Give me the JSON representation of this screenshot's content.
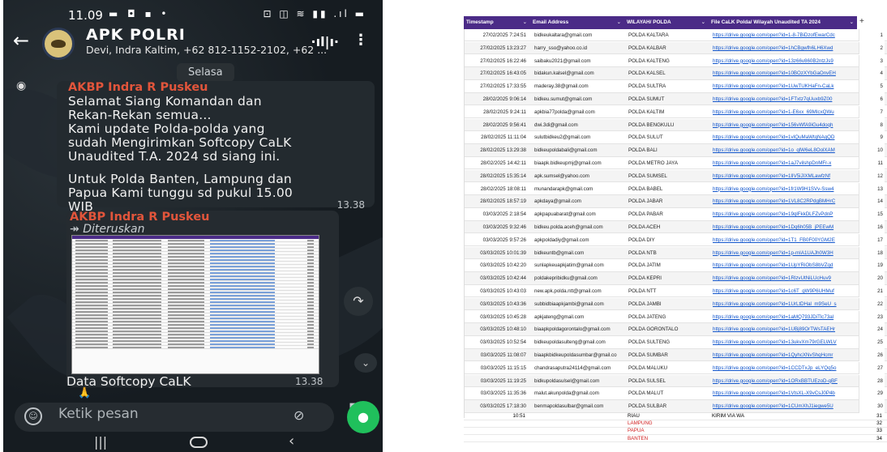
{
  "phone": {
    "status": {
      "time": "11.09"
    },
    "header": {
      "title": "APK POLRI",
      "subtitle": "Devi, Indra Kaltim, +62 812-1152-2102, +62 ..."
    },
    "day_chip": "Selasa",
    "message1": {
      "sender": "AKBP Indra R Puskeu",
      "text1": "Selamat Siang Komandan dan\nRekan-Rekan semua...\nKami update Polda-polda yang\nsudah Mengirimkan Softcopy CaLK\nUnaudited T.A. 2024 sd siang ini.",
      "text2": "Untuk Polda Banten, Lampung dan\nPapua Kami tunggu sd pukul 15.00\nWIB\nDUM, Trims 🙏",
      "time": "13.38"
    },
    "message2": {
      "sender": "AKBP Indra R Puskeu",
      "forwarded": "Diteruskan",
      "caption": "Data Softcopy CaLK",
      "time": "13.38"
    },
    "input_placeholder": "Ketik pesan",
    "accent_green": "#20c05c",
    "sender_color": "#e2553b"
  },
  "sheet": {
    "header_color": "#4b2b87",
    "columns": [
      "Timestamp",
      "Email Address",
      "WILAYAH/ POLDA",
      "File CaLK Polda/ Wilayah Unaudited TA 2024"
    ],
    "rows": [
      {
        "ts": "27/02/2025 7:24:51",
        "email": "bidkeukaltara@gmail.com",
        "polda": "POLDA KALTARA",
        "link": "https://drive.google.com/open?id=1-8-7BiDzofEwarCdc",
        "n": "1"
      },
      {
        "ts": "27/02/2025 13:23:27",
        "email": "harry_sso@yahoo.co.id",
        "polda": "POLDA KALBAR",
        "link": "https://drive.google.com/open?id=1hCBgwfh6LH6Xwd",
        "n": "2"
      },
      {
        "ts": "27/02/2025 16:22:46",
        "email": "saibaku2021@gmail.com",
        "polda": "POLDA KALTENG",
        "link": "https://drive.google.com/open?id=13z66v860B2ntzJs9",
        "n": "3"
      },
      {
        "ts": "27/02/2025 16:43:05",
        "email": "bidakun.kalsel@gmail.com",
        "polda": "POLDA KALSEL",
        "link": "https://drive.google.com/open?id=10BOzXYbGaOnvEH",
        "n": "4"
      },
      {
        "ts": "27/02/2025 17:33:55",
        "email": "maderay.38@gmail.com",
        "polda": "POLDA SULTRA",
        "link": "https://drive.google.com/open?id=1UwTUKHaFn-CaLk",
        "n": "5"
      },
      {
        "ts": "28/02/2025 9:06:14",
        "email": "bidkeu.sumut@gmail.com",
        "polda": "POLDA SUMUT",
        "link": "https://drive.google.com/open?id=1FTxtz7qUuxb9Z00",
        "n": "6"
      },
      {
        "ts": "28/02/2025 9:24:11",
        "email": "apkbia77polda@gmail.com",
        "polda": "POLDA KALTIM",
        "link": "https://drive.google.com/open?id=1-E6xx_69MIcxQWu",
        "n": "7"
      },
      {
        "ts": "28/02/2025 9:56:41",
        "email": "dwi.3di@gmail.com",
        "polda": "POLDA BENGKULU",
        "link": "https://drive.google.com/open?id=156vWfA9iGu4doqh",
        "n": "8"
      },
      {
        "ts": "28/02/2025 11:11:04",
        "email": "sulutbidkeu2@gmail.com",
        "polda": "POLDA SULUT",
        "link": "https://drive.google.com/open?id=1vIQuMaWtqNAqQD",
        "n": "9"
      },
      {
        "ts": "28/02/2025 13:29:38",
        "email": "bidkeupoldabali@gmail.com",
        "polda": "POLDA BALI",
        "link": "https://drive.google.com/open?id=1o_qlW6eL8OolXAM",
        "n": "10"
      },
      {
        "ts": "28/02/2025 14:42:11",
        "email": "biaapk.bidkeupmj@gmail.com",
        "polda": "POLDA METRO JAYA",
        "link": "https://drive.google.com/open?id=1aJ7vilshpDnMFr-x",
        "n": "11"
      },
      {
        "ts": "28/02/2025 15:35:14",
        "email": "apk.sumsel@yahoo.com",
        "polda": "POLDA SUMSEL",
        "link": "https://drive.google.com/open?id=1lIV5iJIXMLawfzNf",
        "n": "12"
      },
      {
        "ts": "28/02/2025 18:08:11",
        "email": "munandarapk@gmail.com",
        "polda": "POLDA BABEL",
        "link": "https://drive.google.com/open?id=1fr1W9H1SVv-Ssw4",
        "n": "13"
      },
      {
        "ts": "28/02/2025 18:57:19",
        "email": "apkdaya@gmail.com",
        "polda": "POLDA JABAR",
        "link": "https://drive.google.com/open?id=1VL8C2RPdgBMHrC",
        "n": "14"
      },
      {
        "ts": "03/03/2025 2:18:54",
        "email": "apkpapuabarat@gmail.com",
        "polda": "POLDA PABAR",
        "link": "https://drive.google.com/open?id=19qlFkkDLFZvPdnP",
        "n": "15"
      },
      {
        "ts": "03/03/2025 9:32:46",
        "email": "bidkeu.polda.aceh@gmail.com",
        "polda": "POLDA ACEH",
        "link": "https://drive.google.com/open?id=1Dq6h05B_jPEEwM",
        "n": "16"
      },
      {
        "ts": "03/03/2025 9:57:26",
        "email": "apkpoldadiy@gmail.com",
        "polda": "POLDA DIY",
        "link": "https://drive.google.com/open?id=1T1_FB0F00YGM2E",
        "n": "17"
      },
      {
        "ts": "03/03/2025 10:01:39",
        "email": "bidkeuntb@gmail.com",
        "polda": "POLDA NTB",
        "link": "https://drive.google.com/open?id=1p-mIA1UAJh0W3H",
        "n": "18"
      },
      {
        "ts": "03/03/2025 10:42:20",
        "email": "sunlapkeuapkjatim@gmail.com",
        "polda": "POLDA JATIM",
        "link": "https://drive.google.com/open?id=1UpYRiObS8bVZqd",
        "n": "19"
      },
      {
        "ts": "03/03/2025 10:42:44",
        "email": "poldakepribidku@gmail.com",
        "polda": "POLDA KEPRI",
        "link": "https://drive.google.com/open?id=1RlzvUtNiLUcHuv9",
        "n": "20"
      },
      {
        "ts": "03/03/2025 10:43:03",
        "email": "new.apk.polda.ntt@gmail.com",
        "polda": "POLDA NTT",
        "link": "https://drive.google.com/open?id=1c6T_gW9P6UHMuf",
        "n": "21"
      },
      {
        "ts": "03/03/2025 10:43:36",
        "email": "subbidbiaapkjambi@gmail.com",
        "polda": "POLDA JAMBI",
        "link": "https://drive.google.com/open?id=1UrLtDHal_m9SeU_s",
        "n": "22"
      },
      {
        "ts": "03/03/2025 10:45:28",
        "email": "apkjateng@gmail.com",
        "polda": "POLDA JATENG",
        "link": "https://drive.google.com/open?id=1aMQ793JDiTlc73al",
        "n": "23"
      },
      {
        "ts": "03/03/2025 10:48:10",
        "email": "biaapkpoldagorontalo@gmail.com",
        "polda": "POLDA GORONTALO",
        "link": "https://drive.google.com/open?id=1UBj89OrTWsTAEHr",
        "n": "24"
      },
      {
        "ts": "03/03/2025 10:52:54",
        "email": "bidkeupoldasulteng@gmail.com",
        "polda": "POLDA SULTENG",
        "link": "https://drive.google.com/open?id=13ukvXm79rGELWLV",
        "n": "25"
      },
      {
        "ts": "03/03/2025 11:08:07",
        "email": "biaapkbidkeupoldasumbar@gmail.co",
        "polda": "POLDA SUMBAR",
        "link": "https://drive.google.com/open?id=1QyhcXNvShqHcmr",
        "n": "26"
      },
      {
        "ts": "03/03/2025 11:15:15",
        "email": "chandrasaputra24114@gmail.com",
        "polda": "POLDA MALUKU",
        "link": "https://drive.google.com/open?id=1CCDTxJp_eLYQq5o",
        "n": "27"
      },
      {
        "ts": "03/03/2025 11:19:25",
        "email": "bidkupoldasulsel@gmail.com",
        "polda": "POLDA SULSEL",
        "link": "https://drive.google.com/open?id=1ORxBBTUEzoD-qBF",
        "n": "28"
      },
      {
        "ts": "03/03/2025 11:35:36",
        "email": "malut.akunpolda@gmail.com",
        "polda": "POLDA MALUT",
        "link": "https://drive.google.com/open?id=1VtsXL-X9vCsJ0P4b",
        "n": "29"
      },
      {
        "ts": "03/03/2025 17:18:30",
        "email": "benmapoldasulbar@gmail.com",
        "polda": "POLDA SULBAR",
        "link": "https://drive.google.com/open?id=1CUmXhJ1iegwe5U",
        "n": "30"
      }
    ],
    "extra_rows": [
      {
        "ts": "10:51",
        "polda": "RIAU",
        "link": "KIRIM VIA WA",
        "n": "31",
        "red": false
      },
      {
        "ts": "",
        "polda": "LAMPUNG",
        "link": "",
        "n": "32",
        "red": true
      },
      {
        "ts": "",
        "polda": "PAPUA",
        "link": "",
        "n": "33",
        "red": true
      },
      {
        "ts": "",
        "polda": "BANTEN",
        "link": "",
        "n": "34",
        "red": true
      }
    ]
  }
}
